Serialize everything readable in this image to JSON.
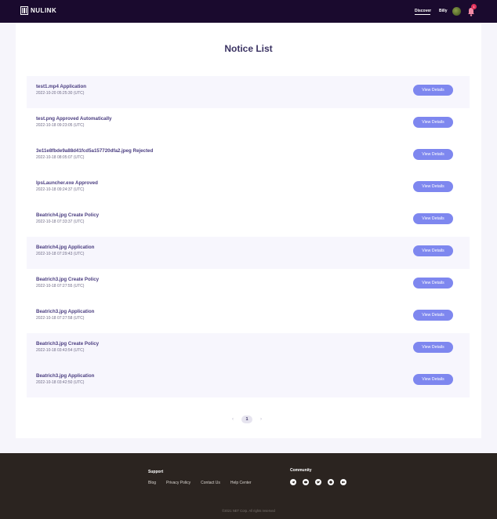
{
  "header": {
    "logo_text": "NULINK",
    "nav": {
      "discover": "Discover",
      "user": "Billy"
    },
    "notification_count": "1"
  },
  "page": {
    "title": "Notice List"
  },
  "notices": [
    {
      "title": "test1.mp4 Application",
      "time": "2022-10-20 05:25:30 (UTC)",
      "button": "View Details"
    },
    {
      "title": "test.png Approved Automatically",
      "time": "2022-10-18 09:23:05 (UTC)",
      "button": "View Details"
    },
    {
      "title": "3e11e8fbde9a88d41fcd5a157720dfa2.jpeg Rejected",
      "time": "2022-10-18 08:05:07 (UTC)",
      "button": "View Details"
    },
    {
      "title": "IpsLauncher.exe Approved",
      "time": "2022-10-18 09:24:37 (UTC)",
      "button": "View Details"
    },
    {
      "title": "Beatrich4.jpg Create Policy",
      "time": "2022-10-18 07:33:37 (UTC)",
      "button": "View Details"
    },
    {
      "title": "Beatrich4.jpg Application",
      "time": "2022-10-18 07:29:43 (UTC)",
      "button": "View Details"
    },
    {
      "title": "Beatrich3.jpg Create Policy",
      "time": "2022-10-18 07:27:55 (UTC)",
      "button": "View Details"
    },
    {
      "title": "Beatrich3.jpg Application",
      "time": "2022-10-18 07:27:58 (UTC)",
      "button": "View Details"
    },
    {
      "title": "Beatrich3.jpg Create Policy",
      "time": "2022-10-18 03:43:54 (UTC)",
      "button": "View Details"
    },
    {
      "title": "Beatrich3.jpg Application",
      "time": "2022-10-18 03:42:50 (UTC)",
      "button": "View Details"
    }
  ],
  "pagination": {
    "prev": "‹",
    "current": "1",
    "next": "›"
  },
  "footer": {
    "support_heading": "Support",
    "links": [
      "Blog",
      "Privacy Policy",
      "Contact Us",
      "Help Center"
    ],
    "community_heading": "Community",
    "social_icons": [
      "telegram-icon",
      "discord-icon",
      "twitter-icon",
      "github-icon",
      "medium-icon"
    ],
    "copyright": "©2021   NET   Corp.   All rights reserved"
  },
  "colors": {
    "header_bg": "#1a0a2e",
    "accent": "#7e87ef",
    "title": "#3b3363",
    "footer_bg": "#2b2420"
  }
}
